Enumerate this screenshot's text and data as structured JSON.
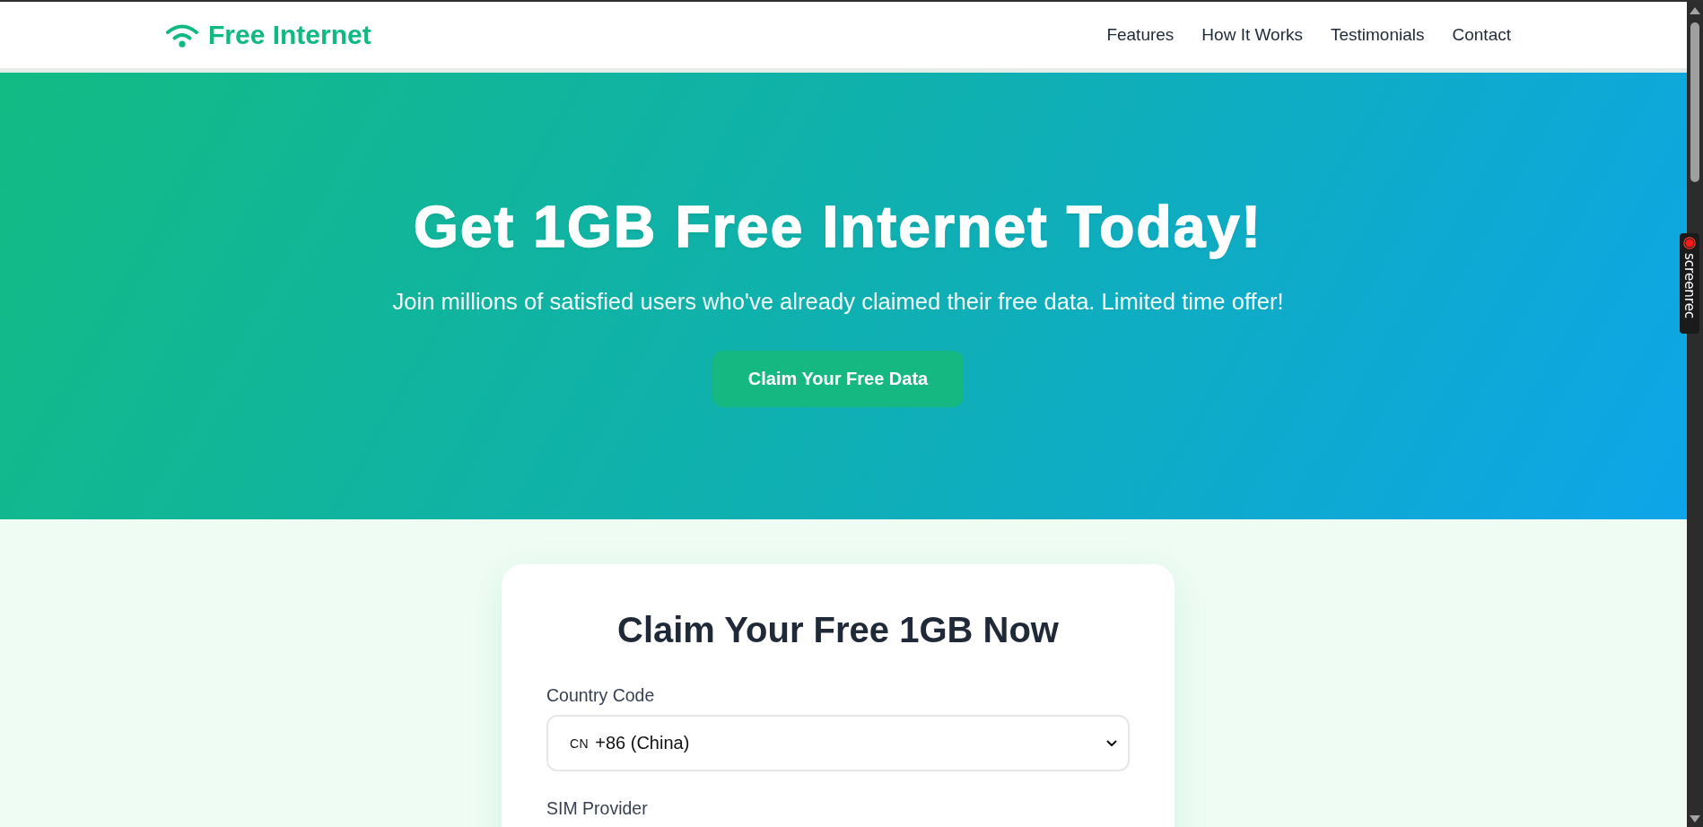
{
  "header": {
    "logo": "Free Internet",
    "nav": [
      "Features",
      "How It Works",
      "Testimonials",
      "Contact"
    ]
  },
  "hero": {
    "title": "Get 1GB Free Internet Today!",
    "subtitle": "Join millions of satisfied users who've already claimed their free data. Limited time offer!",
    "button": "Claim Your Free Data"
  },
  "form": {
    "title": "Claim Your Free 1GB Now",
    "fields": [
      {
        "label": "Country Code",
        "select": {
          "flag": "CN",
          "value": "+86 (China)"
        }
      },
      {
        "label": "SIM Provider"
      }
    ]
  },
  "overlay": {
    "recorder_badge": "screenrec"
  }
}
